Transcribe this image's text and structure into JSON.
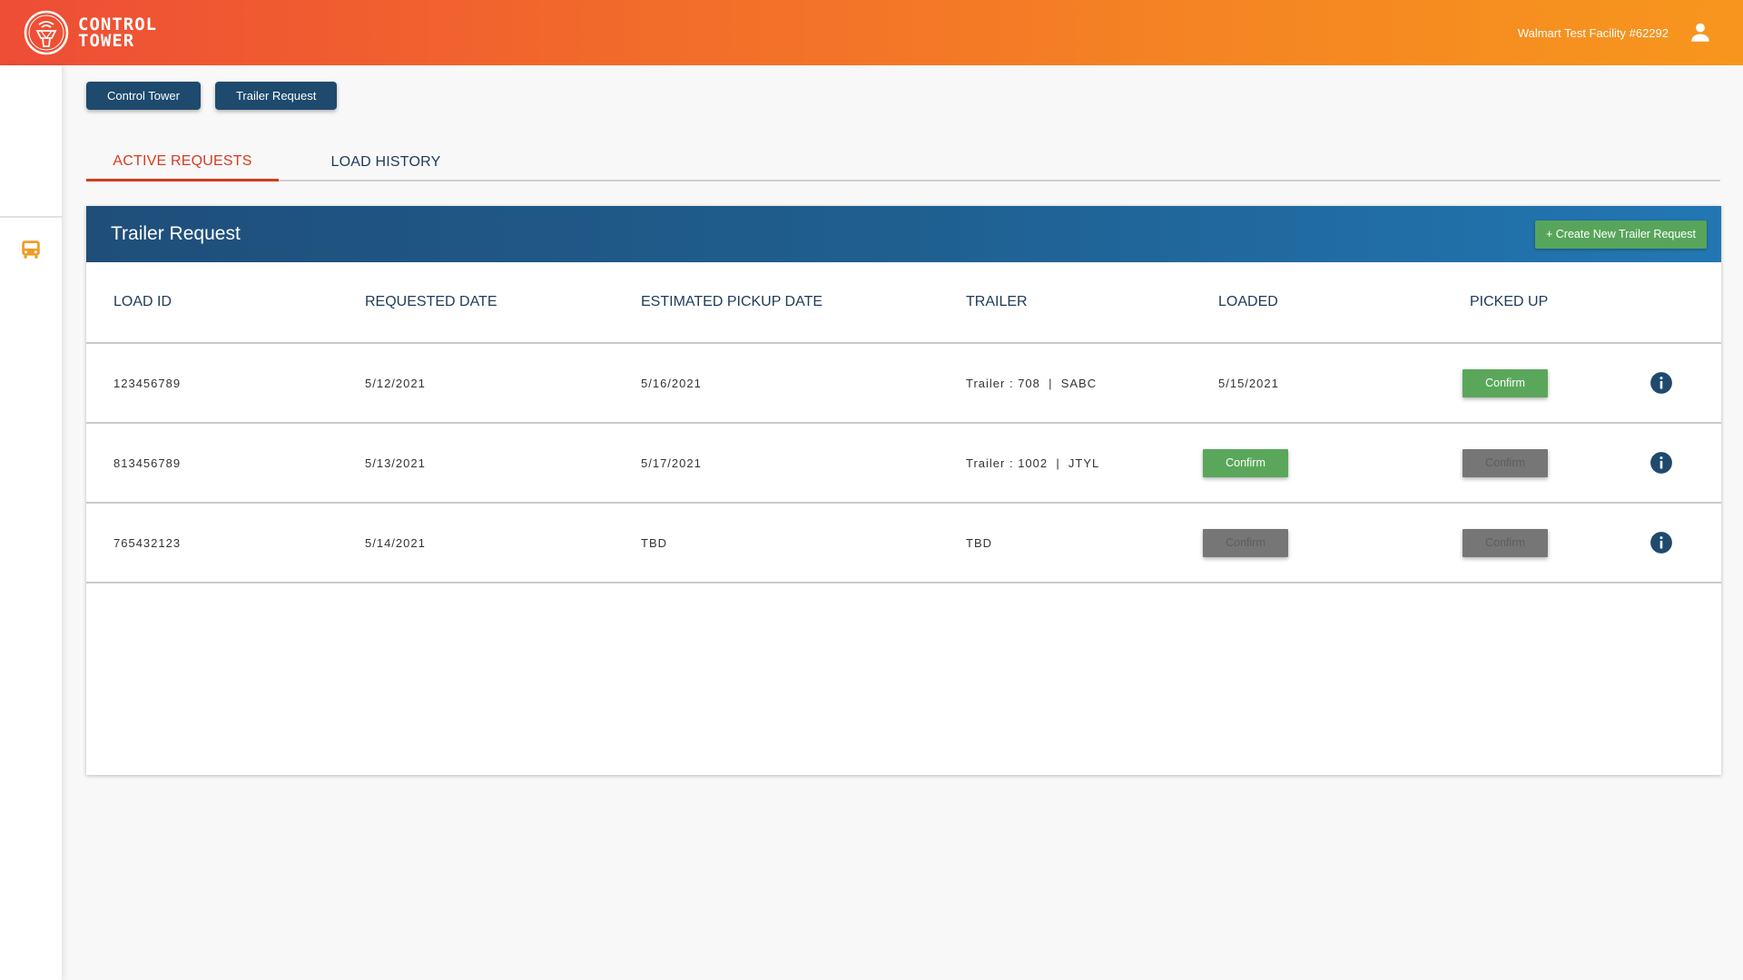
{
  "header": {
    "brand_line1": "CONTROL",
    "brand_line2": "TOWER",
    "facility": "Walmart Test Facility #62292",
    "colors": {
      "gradient_start": "#ee4d36",
      "gradient_end": "#f7961d"
    }
  },
  "sidebar": {
    "items": [
      {
        "icon": "bus-icon",
        "active": true,
        "color": "#f29b24"
      }
    ]
  },
  "top_nav": {
    "control_tower_label": "Control Tower",
    "trailer_request_label": "Trailer Request"
  },
  "tabs": [
    {
      "label": "ACTIVE REQUESTS",
      "active": true
    },
    {
      "label": "LOAD HISTORY",
      "active": false
    }
  ],
  "card": {
    "title": "Trailer Request",
    "create_button_label": "+ Create New Trailer Request"
  },
  "table": {
    "columns": [
      "LOAD ID",
      "REQUESTED DATE",
      "ESTIMATED PICKUP DATE",
      "TRAILER",
      "LOADED",
      "PICKED UP"
    ],
    "rows": [
      {
        "load_id": "123456789",
        "requested_date": "5/12/2021",
        "estimated_pickup_date": "5/16/2021",
        "trailer": "Trailer : 708  |  SABC",
        "loaded": "5/15/2021",
        "picked_up": "Confirm"
      },
      {
        "load_id": "813456789",
        "requested_date": "5/13/2021",
        "estimated_pickup_date": "5/17/2021",
        "trailer": "Trailer : 1002  |  JTYL",
        "loaded": "Confirm",
        "picked_up": "Confirm"
      },
      {
        "load_id": "765432123",
        "requested_date": "5/14/2021",
        "estimated_pickup_date": "TBD",
        "trailer": "TBD",
        "loaded": "Confirm",
        "picked_up": "Confirm"
      }
    ]
  }
}
